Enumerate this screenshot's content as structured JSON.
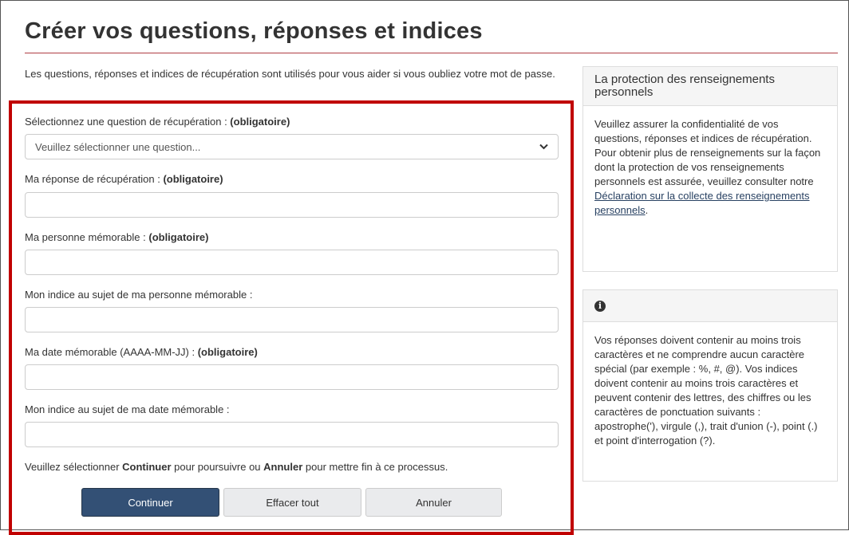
{
  "page": {
    "title": "Créer vos questions, réponses et indices",
    "intro": "Les questions, réponses et indices de récupération sont utilisés pour vous aider si vous oubliez votre mot de passe."
  },
  "form": {
    "required_tag": "(obligatoire)",
    "question": {
      "label": "Sélectionnez une question de récupération : ",
      "selected": "Veuillez sélectionner une question..."
    },
    "answer": {
      "label": "Ma réponse de récupération : "
    },
    "person": {
      "label": "Ma personne mémorable : "
    },
    "person_hint": {
      "label": "Mon indice au sujet de ma personne mémorable :"
    },
    "date": {
      "label": "Ma date mémorable (AAAA-MM-JJ) : "
    },
    "date_hint": {
      "label": "Mon indice au sujet de ma date mémorable :"
    },
    "instruction": {
      "pre": "Veuillez sélectionner ",
      "continue_word": "Continuer",
      "mid": " pour poursuivre ou ",
      "cancel_word": "Annuler",
      "post": " pour mettre fin à ce processus."
    },
    "buttons": {
      "continue": "Continuer",
      "clear": "Effacer tout",
      "cancel": "Annuler"
    }
  },
  "sidebar": {
    "privacy": {
      "heading": "La protection des renseignements personnels",
      "body": "Veuillez assurer la confidentialité de vos questions, réponses et indices de récupération. Pour obtenir plus de renseignements sur la façon dont la protection de vos renseignements personnels est assurée, veuillez consulter notre ",
      "link": "Déclaration sur la collecte des renseignements personnels",
      "tail": "."
    },
    "info": {
      "icon": "info-circle-icon",
      "body": "Vos réponses doivent contenir au moins trois caractères et ne comprendre aucun caractère spécial (par exemple : %, #, @). Vos indices doivent contenir au moins trois caractères et peuvent contenir des lettres, des chiffres ou les caractères de ponctuation suivants : apostrophe('), virgule (,), trait d'union (-), point (.) et point d'interrogation (?)."
    }
  },
  "colors": {
    "primary_button": "#335075",
    "highlight_border": "#c00000",
    "title_rule": "#af3c43"
  }
}
